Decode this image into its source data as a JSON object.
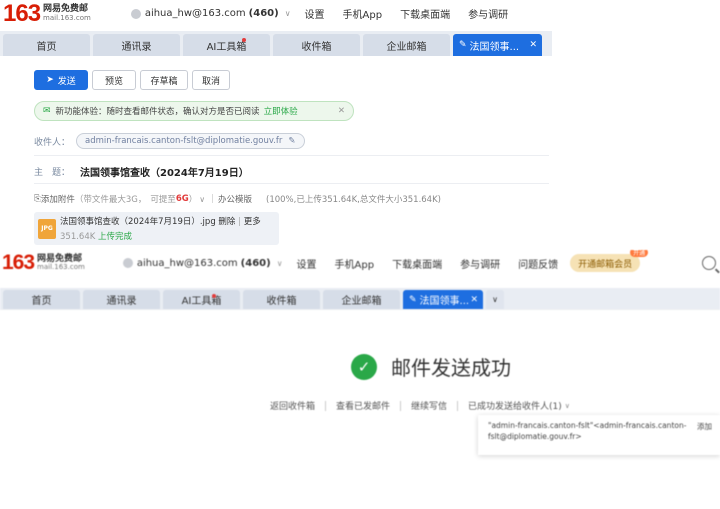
{
  "top": {
    "header": {
      "logo_num": "163",
      "logo_cn": "网易免费邮",
      "logo_domain": "mail.163.com",
      "account": "aihua_hw@163.com",
      "count": "(460)",
      "links": [
        "设置",
        "手机App",
        "下载桌面端",
        "参与调研"
      ]
    },
    "tabs": [
      {
        "label": "首页",
        "w": 58
      },
      {
        "label": "通讯录",
        "w": 87
      },
      {
        "label": "AI工具箱",
        "w": 87,
        "dot": true
      },
      {
        "label": "收件箱",
        "w": 87
      },
      {
        "label": "企业邮箱",
        "w": 87
      }
    ],
    "active_tab": "法国领事...",
    "toolbar": {
      "send": "发送",
      "preview": "预览",
      "draft": "存草稿",
      "cancel": "取消"
    },
    "banner": {
      "text": "新功能体验：随时查看邮件状态，确认对方是否已阅读",
      "link": "立即体验"
    },
    "recipient": {
      "label": "收件人：",
      "value": "admin-francais.canton-fslt@diplomatie.gouv.fr"
    },
    "subject": {
      "label": "主　题：",
      "value": "法国领事馆查收（2024年7月19日）"
    },
    "attach_row": {
      "add": "添加附件",
      "limit_a": "（带文件最大3G，",
      "limit_b": "可提至",
      "limit_c": "6G",
      "limit_d": "）",
      "office": "办公模版",
      "status": "(100%,已上传351.64K,总文件大小351.64K)"
    },
    "attachment": {
      "ext": "JPG",
      "name": "法国领事馆查收（2024年7月19日）.jpg",
      "delete": "删除",
      "more": "更多",
      "size": "351.64K",
      "done": "上传完成"
    }
  },
  "bottom": {
    "header": {
      "logo_num": "163",
      "logo_cn": "网易免费邮",
      "logo_domain": "mail.163.com",
      "account": "aihua_hw@163.com",
      "count": "(460)",
      "links": [
        "设置",
        "手机App",
        "下载桌面端",
        "参与调研",
        "问题反馈"
      ],
      "pill": "开通邮箱会员",
      "pill_badge": "开通"
    },
    "tabs": [
      {
        "label": "首页",
        "w": 80
      },
      {
        "label": "通讯录",
        "w": 80
      },
      {
        "label": "AI工具箱",
        "w": 80,
        "dot": true
      },
      {
        "label": "收件箱",
        "w": 80
      },
      {
        "label": "企业邮箱",
        "w": 80
      }
    ],
    "active_tab": "法国领事...",
    "success": "邮件发送成功",
    "actions": [
      "返回收件箱",
      "查看已发邮件",
      "继续写信",
      "已成功发送给收件人(1)"
    ],
    "popup": {
      "line1": "\"admin-francais.canton-fslt\"<admin-francais.canton-fslt@diplomatie.gouv.fr>",
      "right": "添加"
    }
  }
}
